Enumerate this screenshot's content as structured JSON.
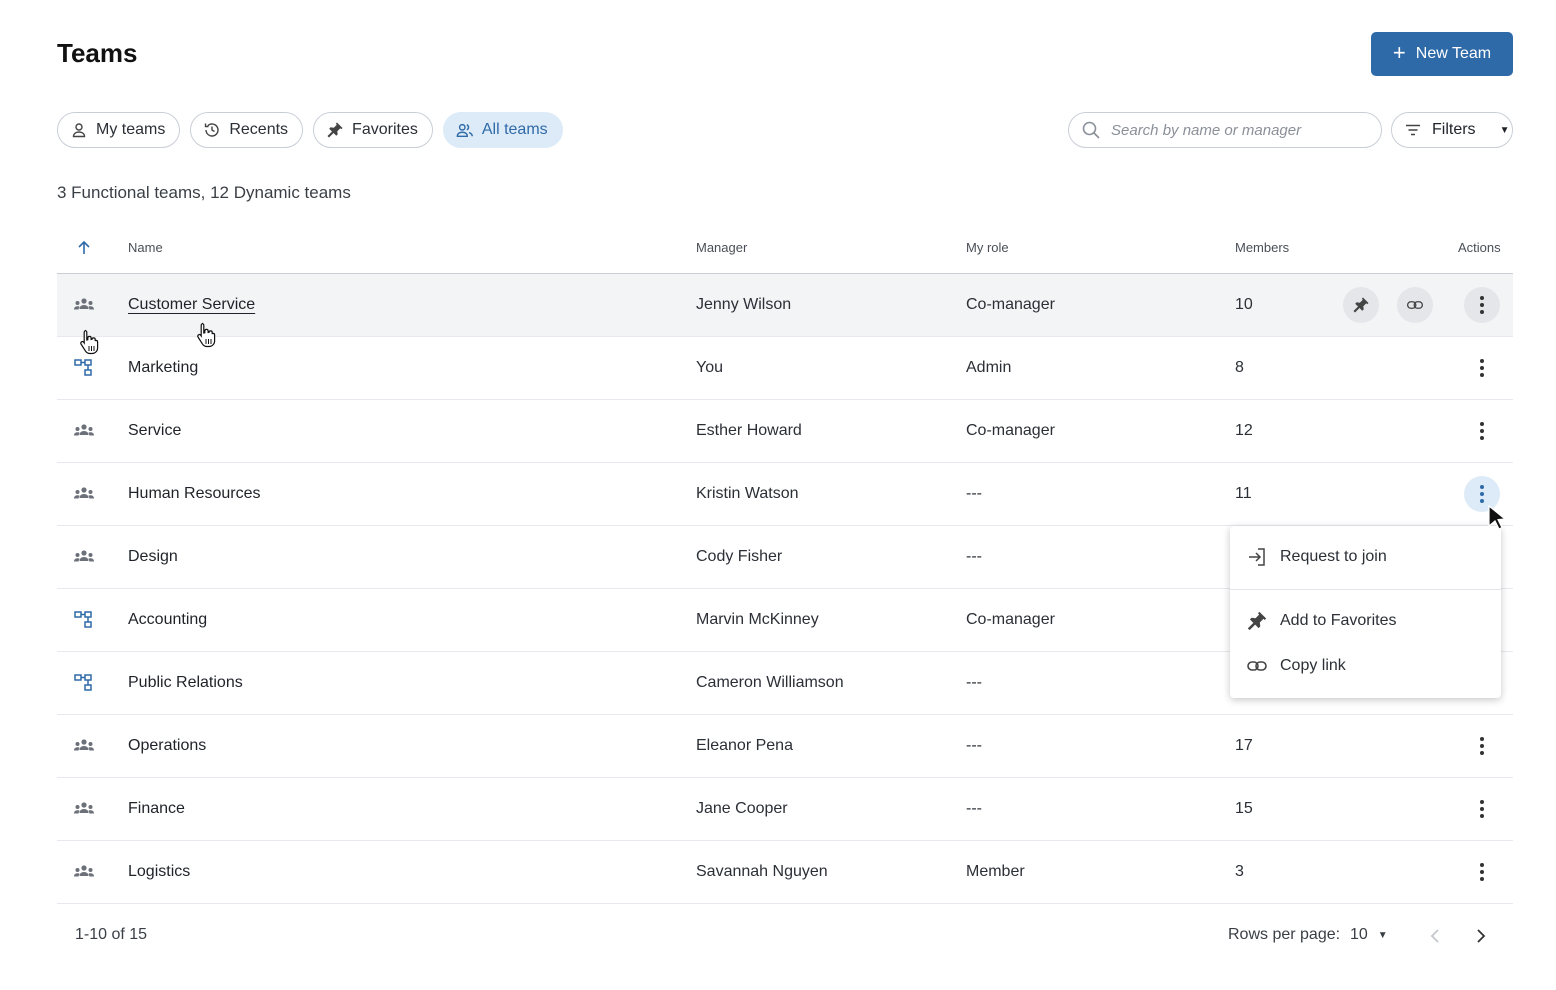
{
  "header": {
    "title": "Teams",
    "new_team_label": "New Team"
  },
  "tabs": [
    {
      "label": "My teams",
      "icon": "person-icon",
      "active": false
    },
    {
      "label": "Recents",
      "icon": "history-icon",
      "active": false
    },
    {
      "label": "Favorites",
      "icon": "pin-icon",
      "active": false
    },
    {
      "label": "All teams",
      "icon": "people-icon",
      "active": true
    }
  ],
  "search": {
    "placeholder": "Search by name or manager",
    "value": ""
  },
  "filters": {
    "label": "Filters"
  },
  "summary": "3 Functional teams, 12 Dynamic teams",
  "table": {
    "sort": {
      "column": "Name",
      "direction": "ascending"
    },
    "headers": {
      "name": "Name",
      "manager": "Manager",
      "role": "My role",
      "members": "Members",
      "actions": "Actions"
    },
    "rows": [
      {
        "type": "functional",
        "name": "Customer Service",
        "manager": "Jenny Wilson",
        "role": "Co-manager",
        "members": "10"
      },
      {
        "type": "dynamic",
        "name": "Marketing",
        "manager": "You",
        "role": "Admin",
        "members": "8"
      },
      {
        "type": "functional",
        "name": "Service",
        "manager": "Esther Howard",
        "role": "Co-manager",
        "members": "12"
      },
      {
        "type": "functional",
        "name": "Human Resources",
        "manager": "Kristin Watson",
        "role": "---",
        "members": "11"
      },
      {
        "type": "functional",
        "name": "Design",
        "manager": "Cody Fisher",
        "role": "---",
        "members": ""
      },
      {
        "type": "dynamic",
        "name": "Accounting",
        "manager": "Marvin McKinney",
        "role": "Co-manager",
        "members": ""
      },
      {
        "type": "dynamic",
        "name": "Public Relations",
        "manager": "Cameron Williamson",
        "role": "---",
        "members": ""
      },
      {
        "type": "functional",
        "name": "Operations",
        "manager": "Eleanor Pena",
        "role": "---",
        "members": "17"
      },
      {
        "type": "functional",
        "name": "Finance",
        "manager": "Jane Cooper",
        "role": "---",
        "members": "15"
      },
      {
        "type": "functional",
        "name": "Logistics",
        "manager": "Savannah Nguyen",
        "role": "Member",
        "members": "3"
      }
    ]
  },
  "context_menu": {
    "items": [
      {
        "label": "Request to join",
        "icon": "login-icon"
      },
      {
        "label": "Add to Favorites",
        "icon": "pin-icon"
      },
      {
        "label": "Copy link",
        "icon": "link-icon"
      }
    ]
  },
  "pagination": {
    "range": "1-10 of 15",
    "rows_per_page_label": "Rows per page:",
    "rows_per_page": "10"
  },
  "colors": {
    "accent": "#2f6aa8",
    "accent_light": "#dcebf7",
    "border": "#c9ced6"
  }
}
